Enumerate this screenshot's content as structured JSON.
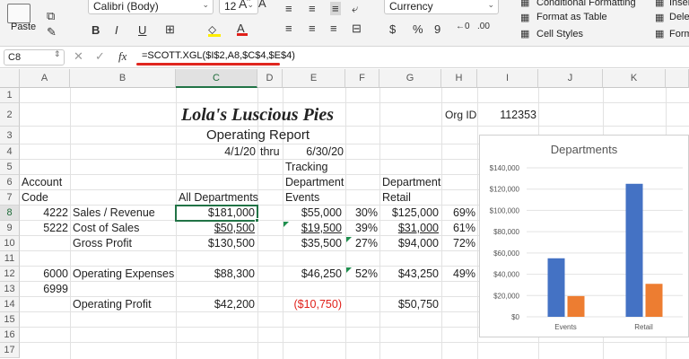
{
  "ribbon": {
    "paste_label": "Paste",
    "font_name": "Calibri (Body)",
    "font_size": "12",
    "number_format": "Currency",
    "conditional_formatting": "Conditional Formatting",
    "format_as_table": "Format as Table",
    "cell_styles": "Cell Styles",
    "insert": "Inser",
    "delete": "Dele",
    "format": "Form",
    "currency_symbol": "$",
    "percent_symbol": "%",
    "comma_symbol": "9"
  },
  "formula_bar": {
    "name_box": "C8",
    "fx": "fx",
    "formula": "=SCOTT.XGL($I$2,A8,$C$4,$E$4)"
  },
  "columns": [
    "A",
    "B",
    "C",
    "D",
    "E",
    "F",
    "G",
    "H",
    "I",
    "J",
    "K"
  ],
  "rows": [
    "1",
    "2",
    "3",
    "4",
    "5",
    "6",
    "7",
    "8",
    "9",
    "10",
    "11",
    "12",
    "13",
    "14",
    "15",
    "16",
    "17"
  ],
  "sheet": {
    "title": "Lola's Luscious Pies",
    "org_id_label": "Org ID",
    "org_id": "112353",
    "subtitle": "Operating Report",
    "date_from": "4/1/20",
    "thru": "thru",
    "date_to": "6/30/20",
    "tracking": "Tracking",
    "account": "Account",
    "code": "Code",
    "department1": "Department",
    "department2": "Department",
    "all_departments": "All Departments",
    "events": "Events",
    "retail": "Retail",
    "r8": {
      "code": "4222",
      "name": "Sales / Revenue",
      "all": "$181,000",
      "events": "$55,000",
      "events_pct": "30%",
      "retail": "$125,000",
      "retail_pct": "69%"
    },
    "r9": {
      "code": "5222",
      "name": "Cost of Sales",
      "all": "$50,500",
      "events": "$19,500",
      "events_pct": "39%",
      "retail": "$31,000",
      "retail_pct": "61%"
    },
    "r10": {
      "name": "Gross Profit",
      "all": "$130,500",
      "events": "$35,500",
      "events_pct": "27%",
      "retail": "$94,000",
      "retail_pct": "72%"
    },
    "r12": {
      "code": "6000",
      "name": "Operating Expenses",
      "all": "$88,300",
      "events": "$46,250",
      "events_pct": "52%",
      "retail": "$43,250",
      "retail_pct": "49%"
    },
    "r13": {
      "code": "6999"
    },
    "r14": {
      "name": "Operating Profit",
      "all": "$42,200",
      "events": "($10,750)",
      "retail": "$50,750"
    }
  },
  "chart_data": {
    "type": "bar",
    "title": "Departments",
    "categories": [
      "Events",
      "Retail"
    ],
    "series": [
      {
        "values": [
          55000,
          125000
        ],
        "color": "#4472c4"
      },
      {
        "values": [
          19500,
          31000
        ],
        "color": "#ed7d31"
      }
    ],
    "ylim": [
      0,
      140000
    ],
    "yticks": [
      "$0",
      "$20,000",
      "$40,000",
      "$60,000",
      "$80,000",
      "$100,000",
      "$120,000",
      "$140,000"
    ],
    "grid": true
  }
}
